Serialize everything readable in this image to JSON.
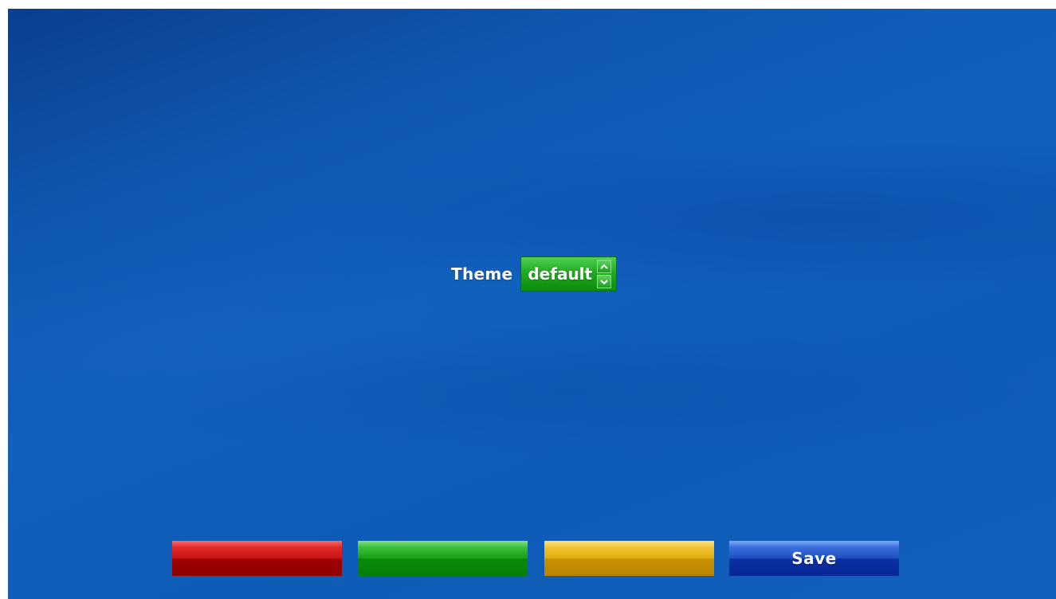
{
  "settings": {
    "theme_label": "Theme",
    "theme_value": "default"
  },
  "buttons": {
    "red_label": "",
    "green_label": "",
    "yellow_label": "",
    "blue_label": "Save"
  },
  "colors": {
    "red": "#c61414",
    "green": "#159e15",
    "yellow": "#e0aa10",
    "blue": "#1e4fc0",
    "background": "#1160bc"
  },
  "icons": {
    "spinner_up": "arrow-up-icon",
    "spinner_down": "arrow-down-icon"
  }
}
